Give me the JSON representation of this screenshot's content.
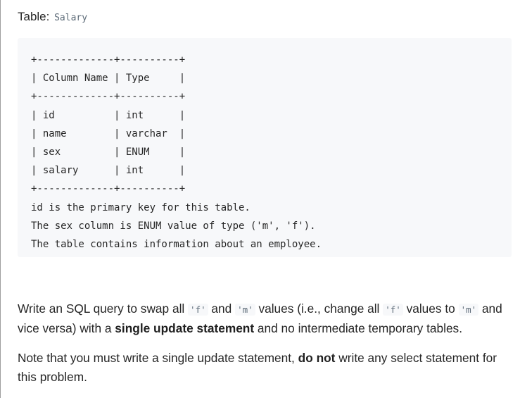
{
  "heading": {
    "label": "Table:",
    "table_name": "Salary"
  },
  "schema_lines": [
    "+-------------+----------+",
    "| Column Name | Type     |",
    "+-------------+----------+",
    "| id          | int      |",
    "| name        | varchar  |",
    "| sex         | ENUM     |",
    "| salary      | int      |",
    "+-------------+----------+",
    "id is the primary key for this table.",
    "The sex column is ENUM value of type ('m', 'f').",
    "The table contains information about an employee."
  ],
  "paragraph1": {
    "t1": "Write an SQL query to swap all ",
    "c1": "'f'",
    "t2": " and ",
    "c2": "'m'",
    "t3": " values (i.e., change all ",
    "c3": "'f'",
    "t4": " values to ",
    "c4": "'m'",
    "t5": " and vice versa) with a ",
    "b1": "single update statement",
    "t6": " and no intermediate temporary tables."
  },
  "paragraph2": {
    "t1": "Note that you must write a single update statement, ",
    "b1": "do not",
    "t2": " write any select statement for this problem."
  }
}
